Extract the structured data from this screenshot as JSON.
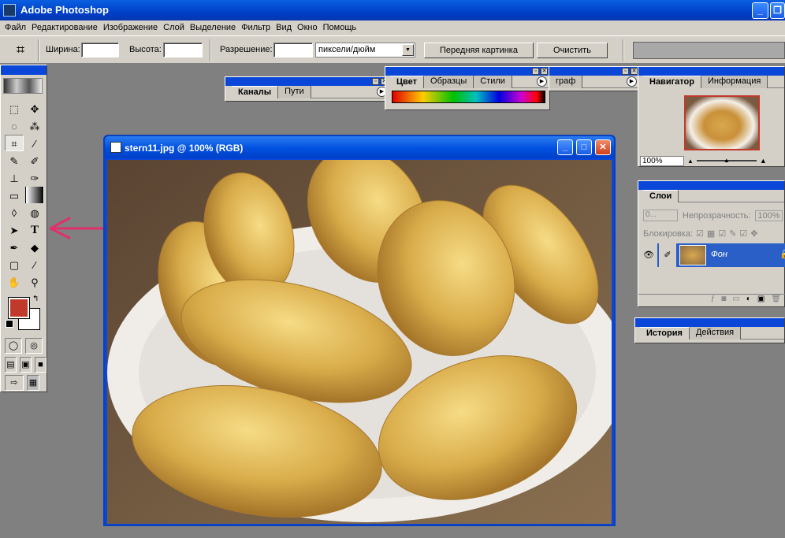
{
  "app": {
    "title": "Adobe Photoshop",
    "window_buttons": [
      "_",
      "❐"
    ]
  },
  "menu": [
    "Файл",
    "Редактирование",
    "Изображение",
    "Слой",
    "Выделение",
    "Фильтр",
    "Вид",
    "Окно",
    "Помощь"
  ],
  "options": {
    "width_label": "Ширина:",
    "height_label": "Высота:",
    "resolution_label": "Разрешение:",
    "units_value": "пиксели/дюйм",
    "front_image_button": "Передняя картинка",
    "clear_button": "Очистить"
  },
  "tools": [
    "marquee-tool",
    "move-tool",
    "lasso-tool",
    "magic-wand-tool",
    "crop-tool",
    "slice-tool",
    "healing-brush-tool",
    "brush-tool",
    "clone-stamp-tool",
    "history-brush-tool",
    "eraser-tool",
    "gradient-tool",
    "blur-tool",
    "dodge-tool",
    "path-selection-tool",
    "type-tool",
    "pen-tool",
    "custom-shape-tool",
    "notes-tool",
    "eyedropper-tool",
    "hand-tool",
    "zoom-tool"
  ],
  "colors": {
    "foreground": "#c0392b",
    "background": "#ffffff",
    "title_blue": "#0a46d8",
    "arrow": "#e0306a"
  },
  "panels": {
    "channels": {
      "tabs": [
        "Каналы",
        "Пути"
      ]
    },
    "color": {
      "tabs": [
        "Цвет",
        "Образцы",
        "Стили"
      ]
    },
    "paragraph": {
      "tab": "граф"
    },
    "navigator": {
      "tabs": [
        "Навигатор",
        "Информация"
      ],
      "zoom": "100%"
    },
    "layers": {
      "tab": "Слои",
      "blend_mode": "0...",
      "opacity_label": "Непрозрачность:",
      "opacity_value": "100%",
      "lock_label": "Блокировка:",
      "layer_name": "Фон"
    },
    "history": {
      "tabs": [
        "История",
        "Действия"
      ]
    }
  },
  "document": {
    "title": "stern11.jpg @ 100% (RGB)"
  }
}
